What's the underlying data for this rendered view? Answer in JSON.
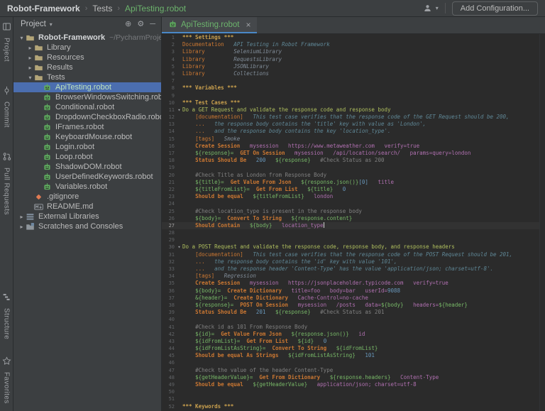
{
  "colors": {
    "bg_editor": "#2B2B2B",
    "bg_panel": "#3C3F41",
    "selection": "#4B6EAF",
    "vcs_added": "#6CB36C",
    "tree_selected_added": "#C0E3BC",
    "tab_underline": "#4A88C7",
    "gutter": "#606366",
    "ui_text": "#BBBBBB",
    "tok_section": "#CBA14E",
    "tok_setting": "#CC7832",
    "tok_keyword": "#CC7832",
    "tok_testcase": "#AFBF5E",
    "tok_doc": "#5F8796",
    "tok_lib": "#808C98",
    "tok_var": "#77B767",
    "tok_arg": "#B070B0",
    "tok_num": "#6897BB",
    "tok_comment": "#808080"
  },
  "icons": {
    "chevron_sep": "›",
    "dropdown_caret": "▾",
    "tree_expanded": "▾",
    "tree_collapsed": "▸",
    "close": "×",
    "locate": "⊕",
    "settings": "⚙",
    "hide": "─",
    "fold": "▾"
  },
  "titlebar": {
    "breadcrumbs": [
      "Robot-Framework",
      "Tests",
      "ApiTesting.robot"
    ],
    "add_configuration_label": "Add Configuration..."
  },
  "tool_stripe": {
    "top": [
      {
        "label": "Project",
        "icon": "project"
      },
      {
        "label": "Commit",
        "icon": "commit"
      },
      {
        "label": "Pull Requests",
        "icon": "pull-requests"
      }
    ],
    "bottom": [
      {
        "label": "Structure",
        "icon": "structure"
      },
      {
        "label": "Favorites",
        "icon": "favorites"
      }
    ]
  },
  "project_panel": {
    "header_title": "Project",
    "tree": [
      {
        "label": "Robot-Framework",
        "suffix": "~/PycharmProjects/R",
        "indent": 0,
        "icon": "folder",
        "chevron": "expanded",
        "bold": true
      },
      {
        "label": "Library",
        "indent": 1,
        "icon": "folder",
        "chevron": "collapsed"
      },
      {
        "label": "Resources",
        "indent": 1,
        "icon": "folder",
        "chevron": "collapsed"
      },
      {
        "label": "Results",
        "indent": 1,
        "icon": "folder",
        "chevron": "collapsed"
      },
      {
        "label": "Tests",
        "indent": 1,
        "icon": "folder",
        "chevron": "expanded"
      },
      {
        "label": "ApiTesting.robot",
        "indent": 2,
        "icon": "robot",
        "chevron": "none",
        "selected": true,
        "vcs": "added"
      },
      {
        "label": "BrowserWindowsSwitching.robot",
        "indent": 2,
        "icon": "robot",
        "chevron": "none"
      },
      {
        "label": "Conditional.robot",
        "indent": 2,
        "icon": "robot",
        "chevron": "none"
      },
      {
        "label": "DropdownCheckboxRadio.robot",
        "indent": 2,
        "icon": "robot",
        "chevron": "none"
      },
      {
        "label": "IFrames.robot",
        "indent": 2,
        "icon": "robot",
        "chevron": "none"
      },
      {
        "label": "KeyboardMouse.robot",
        "indent": 2,
        "icon": "robot",
        "chevron": "none"
      },
      {
        "label": "Login.robot",
        "indent": 2,
        "icon": "robot",
        "chevron": "none"
      },
      {
        "label": "Loop.robot",
        "indent": 2,
        "icon": "robot",
        "chevron": "none"
      },
      {
        "label": "ShadowDOM.robot",
        "indent": 2,
        "icon": "robot",
        "chevron": "none"
      },
      {
        "label": "UserDefinedKeywords.robot",
        "indent": 2,
        "icon": "robot",
        "chevron": "none"
      },
      {
        "label": "Variables.robot",
        "indent": 2,
        "icon": "robot",
        "chevron": "none"
      },
      {
        "label": ".gitignore",
        "indent": 1,
        "icon": "git",
        "chevron": "none"
      },
      {
        "label": "README.md",
        "indent": 1,
        "icon": "markdown",
        "chevron": "none"
      },
      {
        "label": "External Libraries",
        "indent": 0,
        "icon": "libraries",
        "chevron": "collapsed"
      },
      {
        "label": "Scratches and Consoles",
        "indent": 0,
        "icon": "scratches",
        "chevron": "collapsed"
      }
    ]
  },
  "editor": {
    "tab": {
      "label": "ApiTesting.robot"
    },
    "current_line": 27,
    "folds": [
      11,
      30
    ],
    "lines": [
      [
        [
          "sect",
          "*** Settings ***"
        ]
      ],
      [
        [
          "set",
          "Documentation"
        ],
        [
          "sp",
          3
        ],
        [
          "doc",
          "API Testing in Robot Framework"
        ]
      ],
      [
        [
          "set",
          "Library"
        ],
        [
          "sp",
          9
        ],
        [
          "lib",
          "SeleniumLibrary"
        ]
      ],
      [
        [
          "set",
          "Library"
        ],
        [
          "sp",
          9
        ],
        [
          "lib",
          "RequestsLibrary"
        ]
      ],
      [
        [
          "set",
          "Library"
        ],
        [
          "sp",
          9
        ],
        [
          "lib",
          "JSONLibrary"
        ]
      ],
      [
        [
          "set",
          "Library"
        ],
        [
          "sp",
          9
        ],
        [
          "lib",
          "Collections"
        ]
      ],
      [],
      [
        [
          "sect",
          "*** Variables ***"
        ]
      ],
      [],
      [
        [
          "sect",
          "*** Test Cases ***"
        ]
      ],
      [
        [
          "tc",
          "Do a GET Request and validate the response code and response body"
        ]
      ],
      [
        [
          "sp",
          4
        ],
        [
          "set",
          "[documentation]"
        ],
        [
          "sp",
          3
        ],
        [
          "doc",
          "This test case verifies that the response code of the GET Request should be 200,"
        ]
      ],
      [
        [
          "sp",
          4
        ],
        [
          "ell",
          "..."
        ],
        [
          "sp",
          3
        ],
        [
          "doc",
          "the response body contains the 'title' key with value as 'London',"
        ]
      ],
      [
        [
          "sp",
          4
        ],
        [
          "ell",
          "..."
        ],
        [
          "sp",
          3
        ],
        [
          "doc",
          "and the response body contains the key 'location_type'."
        ]
      ],
      [
        [
          "sp",
          4
        ],
        [
          "set",
          "[tags]"
        ],
        [
          "sp",
          3
        ],
        [
          "lib",
          "Smoke"
        ]
      ],
      [
        [
          "sp",
          4
        ],
        [
          "kw",
          "Create Session"
        ],
        [
          "sp",
          3
        ],
        [
          "arg",
          "mysession"
        ],
        [
          "sp",
          3
        ],
        [
          "arg",
          "https://www.metaweather.com"
        ],
        [
          "sp",
          3
        ],
        [
          "arg",
          "verify=true"
        ]
      ],
      [
        [
          "sp",
          4
        ],
        [
          "var",
          "${response}="
        ],
        [
          "sp",
          2
        ],
        [
          "kw",
          "GET On Session"
        ],
        [
          "sp",
          3
        ],
        [
          "arg",
          "mysession"
        ],
        [
          "sp",
          3
        ],
        [
          "arg",
          "/api/location/search/"
        ],
        [
          "sp",
          3
        ],
        [
          "arg",
          "params=query=london"
        ]
      ],
      [
        [
          "sp",
          4
        ],
        [
          "kw",
          "Status Should Be"
        ],
        [
          "sp",
          3
        ],
        [
          "num",
          "200"
        ],
        [
          "sp",
          3
        ],
        [
          "var",
          "${response}"
        ],
        [
          "sp",
          3
        ],
        [
          "com",
          "#Check Status as 200"
        ]
      ],
      [],
      [
        [
          "sp",
          4
        ],
        [
          "com",
          "#Check Title as London from Response Body"
        ]
      ],
      [
        [
          "sp",
          4
        ],
        [
          "var",
          "${title}="
        ],
        [
          "sp",
          2
        ],
        [
          "kw",
          "Get Value From Json"
        ],
        [
          "sp",
          3
        ],
        [
          "var",
          "${response.json()}"
        ],
        [
          "num",
          "[0]"
        ],
        [
          "sp",
          3
        ],
        [
          "arg",
          "title"
        ]
      ],
      [
        [
          "sp",
          4
        ],
        [
          "var",
          "${titleFromList}="
        ],
        [
          "sp",
          2
        ],
        [
          "kw",
          "Get From List"
        ],
        [
          "sp",
          3
        ],
        [
          "var",
          "${title}"
        ],
        [
          "sp",
          3
        ],
        [
          "num",
          "0"
        ]
      ],
      [
        [
          "sp",
          4
        ],
        [
          "kw",
          "Should be equal"
        ],
        [
          "sp",
          3
        ],
        [
          "var",
          "${titleFromList}"
        ],
        [
          "sp",
          3
        ],
        [
          "arg",
          "london"
        ]
      ],
      [],
      [
        [
          "sp",
          4
        ],
        [
          "com",
          "#Check location_type is present in the response body"
        ]
      ],
      [
        [
          "sp",
          4
        ],
        [
          "var",
          "${body}="
        ],
        [
          "sp",
          2
        ],
        [
          "kw",
          "Convert To String"
        ],
        [
          "sp",
          3
        ],
        [
          "var",
          "${response.content}"
        ]
      ],
      [
        [
          "sp",
          4
        ],
        [
          "kw",
          "Should Contain"
        ],
        [
          "sp",
          3
        ],
        [
          "var",
          "${body}"
        ],
        [
          "sp",
          3
        ],
        [
          "arg",
          "location_type"
        ]
      ],
      [],
      [],
      [
        [
          "tc",
          "Do a POST Request and validate the response code, response body, and response headers"
        ]
      ],
      [
        [
          "sp",
          4
        ],
        [
          "set",
          "[documentation]"
        ],
        [
          "sp",
          3
        ],
        [
          "doc",
          "This test case verifies that the response code of the POST Request should be 201,"
        ]
      ],
      [
        [
          "sp",
          4
        ],
        [
          "ell",
          "..."
        ],
        [
          "sp",
          3
        ],
        [
          "doc",
          "the response body contains the 'id' key with value '101',"
        ]
      ],
      [
        [
          "sp",
          4
        ],
        [
          "ell",
          "..."
        ],
        [
          "sp",
          3
        ],
        [
          "doc",
          "and the response header 'Content-Type' has the value 'application/json; charset=utf-8'."
        ]
      ],
      [
        [
          "sp",
          4
        ],
        [
          "set",
          "[tags]"
        ],
        [
          "sp",
          3
        ],
        [
          "lib",
          "Regression"
        ]
      ],
      [
        [
          "sp",
          4
        ],
        [
          "kw",
          "Create Session"
        ],
        [
          "sp",
          3
        ],
        [
          "arg",
          "mysession"
        ],
        [
          "sp",
          3
        ],
        [
          "arg",
          "https://jsonplaceholder.typicode.com"
        ],
        [
          "sp",
          3
        ],
        [
          "arg",
          "verify=true"
        ]
      ],
      [
        [
          "sp",
          4
        ],
        [
          "var",
          "${body}="
        ],
        [
          "sp",
          2
        ],
        [
          "kw",
          "Create Dictionary"
        ],
        [
          "sp",
          3
        ],
        [
          "arg",
          "title=foo"
        ],
        [
          "sp",
          3
        ],
        [
          "arg",
          "body=bar"
        ],
        [
          "sp",
          3
        ],
        [
          "arg",
          "userId="
        ],
        [
          "num",
          "9088"
        ]
      ],
      [
        [
          "sp",
          4
        ],
        [
          "var",
          "&{header}="
        ],
        [
          "sp",
          2
        ],
        [
          "kw",
          "Create Dictionary"
        ],
        [
          "sp",
          3
        ],
        [
          "arg",
          "Cache-Control=no-cache"
        ]
      ],
      [
        [
          "sp",
          4
        ],
        [
          "var",
          "${response}="
        ],
        [
          "sp",
          2
        ],
        [
          "kw",
          "POST On Session"
        ],
        [
          "sp",
          3
        ],
        [
          "arg",
          "mysession"
        ],
        [
          "sp",
          3
        ],
        [
          "arg",
          "/posts"
        ],
        [
          "sp",
          3
        ],
        [
          "arg",
          "data="
        ],
        [
          "var",
          "${body}"
        ],
        [
          "sp",
          3
        ],
        [
          "arg",
          "headers="
        ],
        [
          "var",
          "${header}"
        ]
      ],
      [
        [
          "sp",
          4
        ],
        [
          "kw",
          "Status Should Be"
        ],
        [
          "sp",
          3
        ],
        [
          "num",
          "201"
        ],
        [
          "sp",
          3
        ],
        [
          "var",
          "${response}"
        ],
        [
          "sp",
          3
        ],
        [
          "com",
          "#Check Status as 201"
        ]
      ],
      [],
      [
        [
          "sp",
          4
        ],
        [
          "com",
          "#Check id as 101 From Response Body"
        ]
      ],
      [
        [
          "sp",
          4
        ],
        [
          "var",
          "${id}="
        ],
        [
          "sp",
          2
        ],
        [
          "kw",
          "Get Value From Json"
        ],
        [
          "sp",
          3
        ],
        [
          "var",
          "${response.json()}"
        ],
        [
          "sp",
          3
        ],
        [
          "arg",
          "id"
        ]
      ],
      [
        [
          "sp",
          4
        ],
        [
          "var",
          "${idFromList}="
        ],
        [
          "sp",
          2
        ],
        [
          "kw",
          "Get From List"
        ],
        [
          "sp",
          3
        ],
        [
          "var",
          "${id}"
        ],
        [
          "sp",
          3
        ],
        [
          "num",
          "0"
        ]
      ],
      [
        [
          "sp",
          4
        ],
        [
          "var",
          "${idFromListAsString}="
        ],
        [
          "sp",
          2
        ],
        [
          "kw",
          "Convert To String"
        ],
        [
          "sp",
          3
        ],
        [
          "var",
          "${idFromList}"
        ]
      ],
      [
        [
          "sp",
          4
        ],
        [
          "kw",
          "Should be equal As Strings"
        ],
        [
          "sp",
          3
        ],
        [
          "var",
          "${idFromListAsString}"
        ],
        [
          "sp",
          3
        ],
        [
          "num",
          "101"
        ]
      ],
      [],
      [
        [
          "sp",
          4
        ],
        [
          "com",
          "#Check the value of the header Content-Type"
        ]
      ],
      [
        [
          "sp",
          4
        ],
        [
          "var",
          "${getHeaderValue}="
        ],
        [
          "sp",
          2
        ],
        [
          "kw",
          "Get From Dictionary"
        ],
        [
          "sp",
          3
        ],
        [
          "var",
          "${response.headers}"
        ],
        [
          "sp",
          3
        ],
        [
          "arg",
          "Content-Type"
        ]
      ],
      [
        [
          "sp",
          4
        ],
        [
          "kw",
          "Should be equal"
        ],
        [
          "sp",
          3
        ],
        [
          "var",
          "${getHeaderValue}"
        ],
        [
          "sp",
          3
        ],
        [
          "arg",
          "application/json; charset=utf-8"
        ]
      ],
      [],
      [],
      [
        [
          "sect",
          "*** Keywords ***"
        ]
      ]
    ]
  }
}
